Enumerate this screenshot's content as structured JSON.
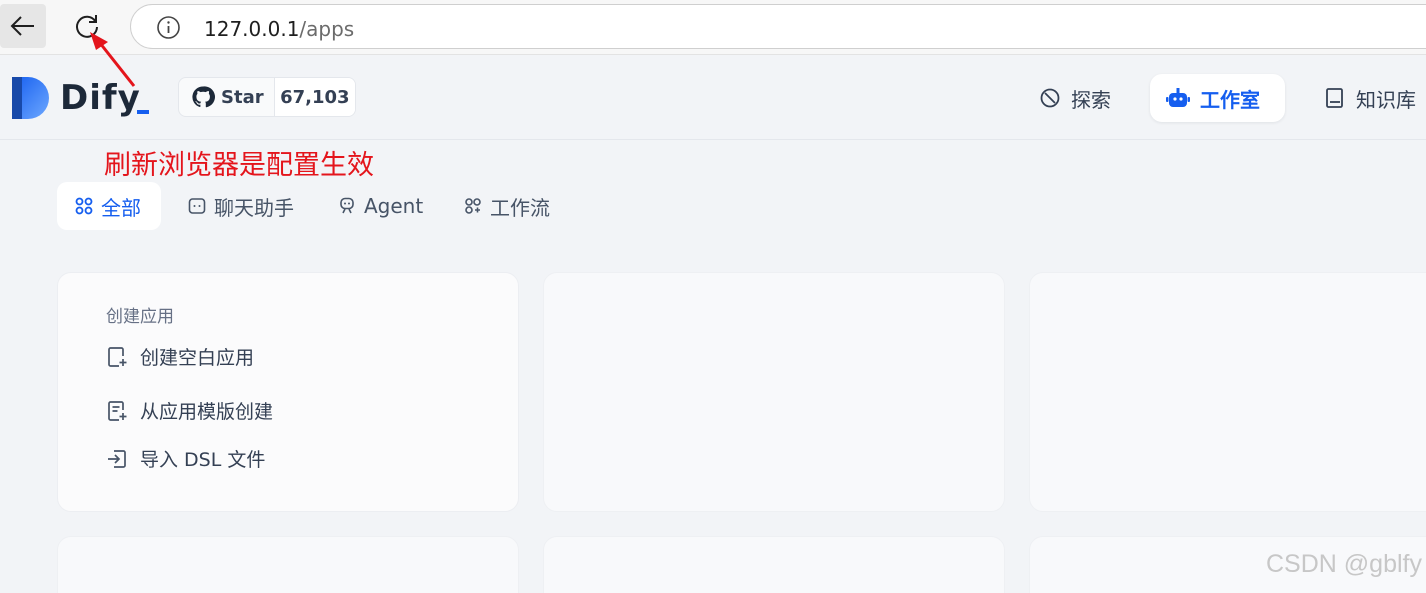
{
  "browser": {
    "url_host": "127.0.0.1",
    "url_path": "/apps",
    "icons": {
      "back": "arrow-left-icon",
      "reload": "reload-icon",
      "info": "info-circle-icon"
    }
  },
  "header": {
    "logo_text": "Dify",
    "github": {
      "label": "Star",
      "count": "67,103",
      "icon": "github-icon"
    },
    "nav": [
      {
        "label": "探索",
        "icon": "compass-icon",
        "active": false
      },
      {
        "label": "工作室",
        "icon": "robot-icon",
        "active": true
      },
      {
        "label": "知识库",
        "icon": "book-icon",
        "active": false
      }
    ]
  },
  "annotation": {
    "text": "刷新浏览器是配置生效",
    "color": "#e4151c"
  },
  "tabs": [
    {
      "label": "全部",
      "icon": "grid-icon",
      "active": true
    },
    {
      "label": "聊天助手",
      "icon": "chat-bubble-icon",
      "active": false
    },
    {
      "label": "Agent",
      "icon": "agent-icon",
      "active": false
    },
    {
      "label": "工作流",
      "icon": "workflow-icon",
      "active": false
    }
  ],
  "create_card": {
    "title": "创建应用",
    "items": [
      {
        "label": "创建空白应用",
        "icon": "file-plus-icon"
      },
      {
        "label": "从应用模版创建",
        "icon": "template-plus-icon"
      },
      {
        "label": "导入 DSL 文件",
        "icon": "import-icon"
      }
    ]
  },
  "watermark": "CSDN @gblfy",
  "colors": {
    "accent": "#155eef",
    "background": "#f2f4f7",
    "annotation": "#e4151c"
  }
}
